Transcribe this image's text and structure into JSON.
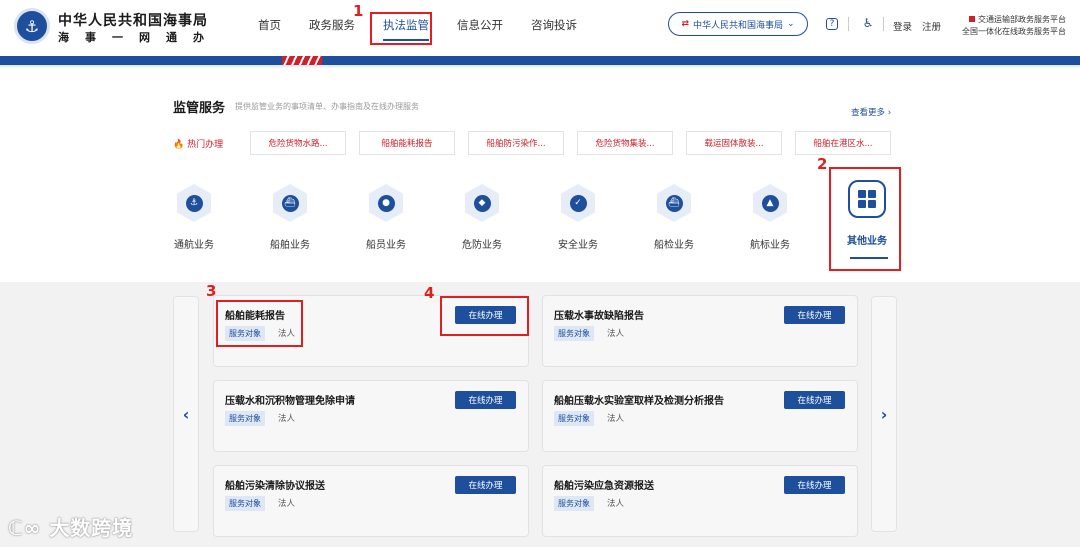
{
  "header": {
    "org_title": "中华人民共和国海事局",
    "org_subtitle": "海事一网通办",
    "nav": [
      "首页",
      "政务服务",
      "执法监管",
      "信息公开",
      "咨询投诉"
    ],
    "active_nav": "执法监管",
    "org_select": "中华人民共和国海事局",
    "login": "登录",
    "register": "注册",
    "platform_line1": "交通运输部政务服务平台",
    "platform_line2": "全国一体化在线政务服务平台"
  },
  "supervision": {
    "title": "监管服务",
    "description": "提供监管业务的事项清单、办事指南及在线办理服务",
    "see_more": "查看更多 ›",
    "hot_label": "热门办理",
    "hot_items": [
      "危险货物水路...",
      "船舶能耗报告",
      "船舶防污染作...",
      "危险货物集装...",
      "载运固体散装...",
      "船舶在港区水..."
    ],
    "categories": [
      {
        "label": "通航业务",
        "icon": "anchor-icon"
      },
      {
        "label": "船舶业务",
        "icon": "ship-icon"
      },
      {
        "label": "船员业务",
        "icon": "crew-icon"
      },
      {
        "label": "危防业务",
        "icon": "hazard-shield-icon"
      },
      {
        "label": "安全业务",
        "icon": "safety-check-icon"
      },
      {
        "label": "船检业务",
        "icon": "ship-inspection-icon"
      },
      {
        "label": "航标业务",
        "icon": "lighthouse-icon"
      },
      {
        "label": "其他业务",
        "icon": "grid-icon"
      }
    ],
    "active_category": "其他业务"
  },
  "services": [
    {
      "title": "船舶能耗报告",
      "tag": "服务对象",
      "target": "法人",
      "button": "在线办理"
    },
    {
      "title": "压载水事故缺陷报告",
      "tag": "服务对象",
      "target": "法人",
      "button": "在线办理"
    },
    {
      "title": "压载水和沉积物管理免除申请",
      "tag": "服务对象",
      "target": "法人",
      "button": "在线办理"
    },
    {
      "title": "船舶压载水实验室取样及检测分析报告",
      "tag": "服务对象",
      "target": "法人",
      "button": "在线办理"
    },
    {
      "title": "船舶污染清除协议报送",
      "tag": "服务对象",
      "target": "法人",
      "button": "在线办理"
    },
    {
      "title": "船舶污染应急资源报送",
      "tag": "服务对象",
      "target": "法人",
      "button": "在线办理"
    }
  ],
  "annotations": [
    "1",
    "2",
    "3",
    "4"
  ],
  "watermark": "大数跨境",
  "colors": {
    "primary": "#1d4f9c",
    "accent_red": "#d0202a",
    "annotation": "#e02020"
  }
}
